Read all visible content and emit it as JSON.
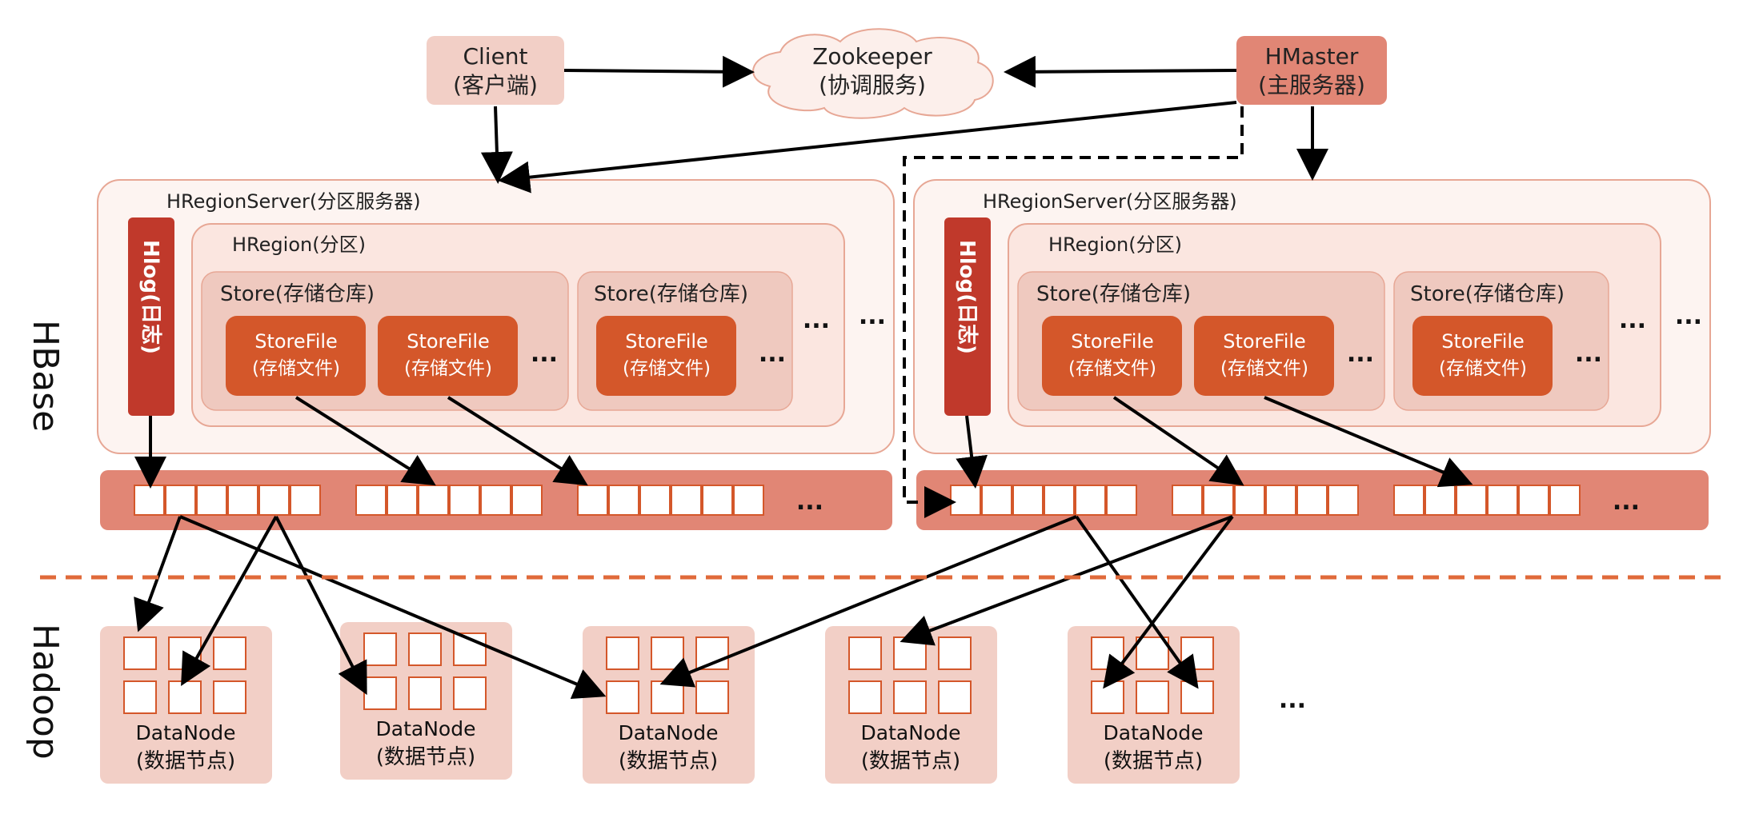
{
  "client": {
    "name": "Client",
    "sub": "(客户端)"
  },
  "zookeeper": {
    "name": "Zookeeper",
    "sub": "(协调服务)"
  },
  "hmaster": {
    "name": "HMaster",
    "sub": "(主服务器)"
  },
  "hregionserver_label": "HRegionServer(分区服务器)",
  "hregion_label": "HRegion(分区)",
  "hlog_label": "Hlog(日志)",
  "store_label": "Store(存储仓库)",
  "storefile": {
    "name": "StoreFile",
    "sub": "(存储文件)"
  },
  "ellipsis": "...",
  "layers": {
    "hbase": "HBase",
    "hadoop": "Hadoop"
  },
  "datanode": {
    "name": "DataNode",
    "sub": "(数据节点)"
  },
  "colors": {
    "dark_red": "#c0392b",
    "orange": "#d4572a",
    "salmon": "#e18675",
    "light_pink": "#f2cfc6",
    "pale_pink": "#fcefeb",
    "store_bg": "#efc9bf",
    "border": "#e7a795",
    "arrow": "#000000"
  }
}
